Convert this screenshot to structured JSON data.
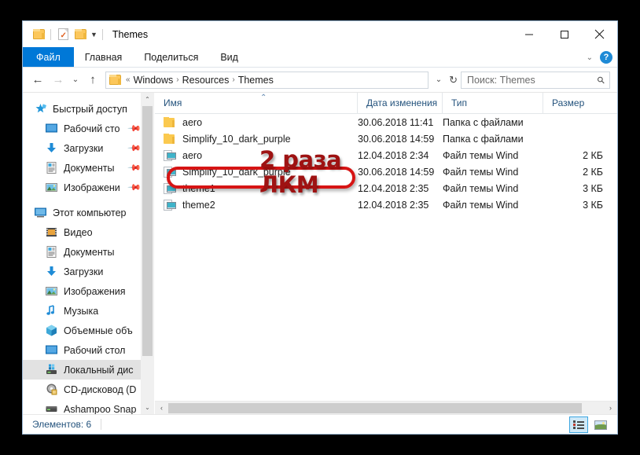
{
  "window": {
    "title": "Themes",
    "quick_access": [
      "folder-icon",
      "properties-icon",
      "new-folder-icon",
      "customize-caret-icon"
    ],
    "controls": {
      "minimize": "minimize-icon",
      "maximize": "maximize-icon",
      "close": "close-icon"
    }
  },
  "ribbon": {
    "tabs": [
      {
        "label": "Файл",
        "active": true
      },
      {
        "label": "Главная",
        "active": false
      },
      {
        "label": "Поделиться",
        "active": false
      },
      {
        "label": "Вид",
        "active": false
      }
    ],
    "expand_caret": "chevron-down-icon",
    "help_label": "?"
  },
  "address": {
    "back": "back-arrow-icon",
    "forward": "forward-arrow-icon",
    "recent": "chevron-down-icon",
    "up": "up-arrow-icon",
    "overflow": "«",
    "crumbs": [
      "Windows",
      "Resources",
      "Themes"
    ],
    "separator": "›",
    "dropdown": "chevron-down-icon",
    "refresh": "refresh-icon"
  },
  "search": {
    "placeholder": "Поиск: Themes",
    "icon": "search-icon"
  },
  "sidebar": {
    "groups": [
      {
        "header": {
          "label": "Быстрый доступ",
          "icon": "quick-access-star-icon"
        },
        "items": [
          {
            "label": "Рабочий сто",
            "icon": "desktop-icon",
            "pinned": true
          },
          {
            "label": "Загрузки",
            "icon": "downloads-icon",
            "pinned": true
          },
          {
            "label": "Документы",
            "icon": "documents-icon",
            "pinned": true
          },
          {
            "label": "Изображени",
            "icon": "pictures-icon",
            "pinned": true
          }
        ]
      },
      {
        "header": {
          "label": "Этот компьютер",
          "icon": "this-pc-icon"
        },
        "items": [
          {
            "label": "Видео",
            "icon": "videos-icon",
            "pinned": false
          },
          {
            "label": "Документы",
            "icon": "documents-icon",
            "pinned": false
          },
          {
            "label": "Загрузки",
            "icon": "downloads-icon",
            "pinned": false
          },
          {
            "label": "Изображения",
            "icon": "pictures-icon",
            "pinned": false
          },
          {
            "label": "Музыка",
            "icon": "music-icon",
            "pinned": false
          },
          {
            "label": "Объемные объ",
            "icon": "3d-objects-icon",
            "pinned": false
          },
          {
            "label": "Рабочий стол",
            "icon": "desktop-icon",
            "pinned": false
          },
          {
            "label": "Локальный дис",
            "icon": "local-disk-icon",
            "pinned": false,
            "selected": true
          },
          {
            "label": "CD-дисковод (D",
            "icon": "cd-drive-icon",
            "pinned": false
          },
          {
            "label": "Ashampoo Snap",
            "icon": "drive-icon",
            "pinned": false
          }
        ]
      }
    ],
    "scroll_up": "scroll-up-icon",
    "scroll_down": "scroll-down-icon"
  },
  "columns": [
    {
      "key": "name",
      "label": "Имя"
    },
    {
      "key": "date",
      "label": "Дата изменения"
    },
    {
      "key": "type",
      "label": "Тип"
    },
    {
      "key": "size",
      "label": "Размер"
    }
  ],
  "files": [
    {
      "name": "aero",
      "date": "30.06.2018 11:41",
      "type": "Папка с файлами",
      "size": "",
      "icon": "folder-icon"
    },
    {
      "name": "Simplify_10_dark_purple",
      "date": "30.06.2018 14:59",
      "type": "Папка с файлами",
      "size": "",
      "icon": "folder-icon"
    },
    {
      "name": "aero",
      "date": "12.04.2018 2:34",
      "type": "Файл темы Wind",
      "size": "2 КБ",
      "icon": "theme-file-icon"
    },
    {
      "name": "Simplify_10_dark_purple",
      "date": "30.06.2018 14:59",
      "type": "Файл темы Wind",
      "size": "2 КБ",
      "icon": "theme-file-icon",
      "highlighted": true
    },
    {
      "name": "theme1",
      "date": "12.04.2018 2:35",
      "type": "Файл темы Wind",
      "size": "3 КБ",
      "icon": "theme-file-icon"
    },
    {
      "name": "theme2",
      "date": "12.04.2018 2:35",
      "type": "Файл темы Wind",
      "size": "3 КБ",
      "icon": "theme-file-icon"
    }
  ],
  "annotation": {
    "line1": "2 раза",
    "line2": "ЛКМ",
    "color": "#9e1212",
    "ellipse_color": "#d61414"
  },
  "statusbar": {
    "items_text": "Элементов: 6",
    "view_details": "details-view-icon",
    "view_large_icons": "large-icons-view-icon"
  }
}
